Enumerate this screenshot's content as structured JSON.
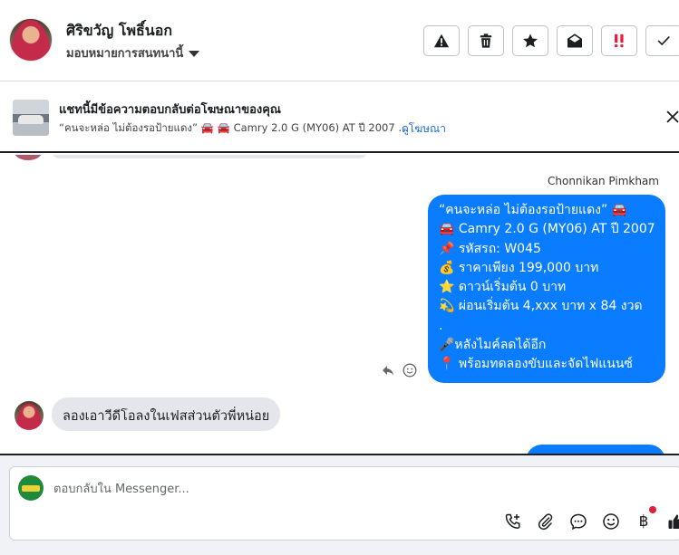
{
  "header": {
    "contact_name": "ศิริขวัญ โพธิ์นอก",
    "assign_label": "มอบหมายการสนทนานี้",
    "actions": [
      {
        "name": "report-icon"
      },
      {
        "name": "trash-icon"
      },
      {
        "name": "star-icon"
      },
      {
        "name": "mark-unread-icon"
      },
      {
        "name": "priority-icon"
      },
      {
        "name": "done-check-icon"
      }
    ]
  },
  "ad_banner": {
    "title": "แชทนี้มีข้อความตอบกลับต่อโฆษณาของคุณ",
    "subtitle": "“คนจะหล่อ ไม่ต้องรอป้ายแดง” 🚘 🚘 Camry 2.0 G (MY06) AT ปี 2007 ...",
    "link_label": "ดูโฆษณา"
  },
  "conversation": {
    "sender_name": "Chonnikan Pimkham",
    "outgoing_message": [
      "“คนจะหล่อ ไม่ต้องรอป้ายแดง” 🚘",
      "🚘 Camry 2.0 G (MY06) AT ปี 2007",
      "📌 รหัสรถ: W045",
      "💰 ราคาเพียง 199,000 บาท",
      "⭐ ดาวน์เริ่มต้น 0 บาท",
      "💫 ผ่อนเริ่มต้น 4,xxx บาท x 84 งวด",
      ".",
      "🎤หลังไมค์ลดได้อีก",
      "📍 พร้อมทดลองขับและจัดไฟแนนซ์"
    ],
    "incoming_message": "ลองเอาวีดีโอลงในเฟสส่วนตัวพี่หน่อย"
  },
  "composer": {
    "placeholder": "ตอบกลับใน Messenger...",
    "value": "",
    "baht_symbol": "฿"
  },
  "colors": {
    "accent": "#0a7cff",
    "link": "#216fdb",
    "incoming_bubble": "#e4e6eb",
    "notification_dot": "#e41e3f"
  }
}
